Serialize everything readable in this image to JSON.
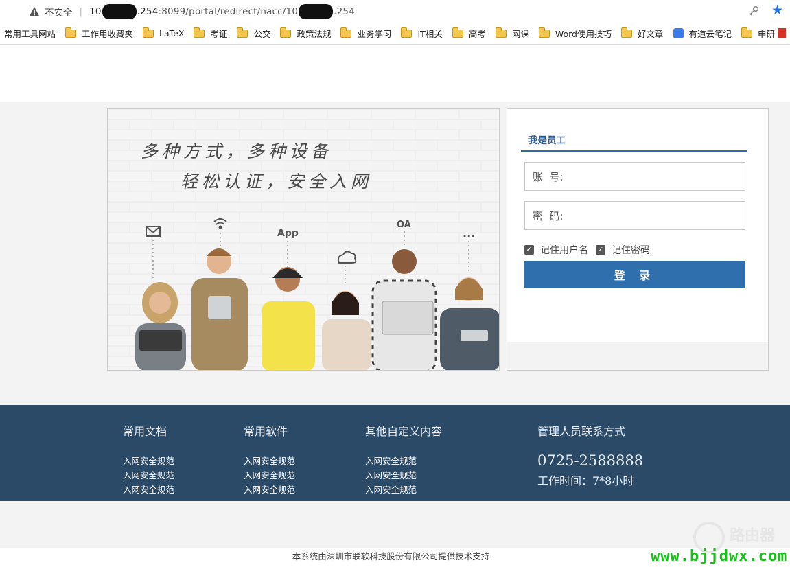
{
  "browser": {
    "insecure_label": "不安全",
    "url_prefix": "10",
    "url_mid": ".254",
    "url_path": ":8099/portal/redirect/nacc/10",
    "url_suffix": ".254"
  },
  "bookmarks": [
    {
      "label": "常用工具网站",
      "icon": "none"
    },
    {
      "label": "工作用收藏夹",
      "icon": "folder-icon"
    },
    {
      "label": "LaTeX",
      "icon": "folder-icon"
    },
    {
      "label": "考证",
      "icon": "folder-icon"
    },
    {
      "label": "公交",
      "icon": "folder-icon"
    },
    {
      "label": "政策法规",
      "icon": "folder-icon"
    },
    {
      "label": "业务学习",
      "icon": "folder-icon"
    },
    {
      "label": "IT相关",
      "icon": "folder-icon"
    },
    {
      "label": "高考",
      "icon": "folder-icon"
    },
    {
      "label": "网课",
      "icon": "folder-icon"
    },
    {
      "label": "Word使用技巧",
      "icon": "folder-icon"
    },
    {
      "label": "好文章",
      "icon": "folder-icon"
    },
    {
      "label": "有道云笔记",
      "icon": "youdao-icon"
    },
    {
      "label": "申研",
      "icon": "folder-icon"
    }
  ],
  "hero": {
    "line1": "多种方式，多种设备",
    "line2": "轻松认证，安全入网",
    "icon_app": "App",
    "icon_oa": "OA",
    "icon_more": "···"
  },
  "login": {
    "tab": "我是员工",
    "username_label": "账  号:",
    "password_label": "密  码:",
    "remember_user": "记住用户名",
    "remember_pass": "记住密码",
    "submit": "登 录"
  },
  "footer": {
    "col1": {
      "title": "常用文档",
      "links": [
        "入网安全规范",
        "入网安全规范",
        "入网安全规范"
      ]
    },
    "col2": {
      "title": "常用软件",
      "links": [
        "入网安全规范",
        "入网安全规范",
        "入网安全规范"
      ]
    },
    "col3": {
      "title": "其他自定义内容",
      "links": [
        "入网安全规范",
        "入网安全规范",
        "入网安全规范"
      ]
    },
    "contact": {
      "title": "管理人员联系方式",
      "phone": "0725-2588888",
      "hours": "工作时间：7*8小时"
    }
  },
  "credit": "本系统由深圳市联软科技股份有限公司提供技术支持",
  "watermark": {
    "site": "www.bjjdwx.com",
    "cn": "路由器"
  },
  "colors": {
    "primary": "#2f6fae",
    "footer": "#2b4a68",
    "band": "#f3f3f3"
  }
}
